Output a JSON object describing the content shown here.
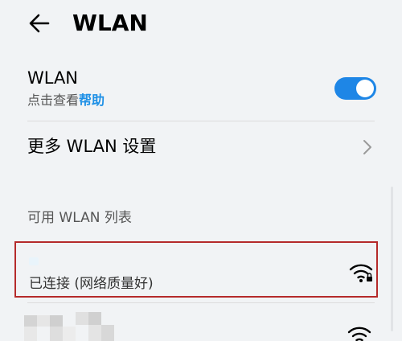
{
  "header": {
    "title": "WLAN",
    "back_icon": "back-arrow-icon"
  },
  "wlan": {
    "label": "WLAN",
    "subtitle_prefix": "点击查看",
    "subtitle_link": "帮助",
    "enabled": true,
    "accent_color": "#1e86e6"
  },
  "more_settings": {
    "label": "更多 WLAN 设置"
  },
  "available": {
    "header": "可用 WLAN 列表",
    "networks": [
      {
        "status": "已连接 (网络质量好)",
        "secured": true
      },
      {
        "status": "",
        "secured": false
      }
    ]
  }
}
